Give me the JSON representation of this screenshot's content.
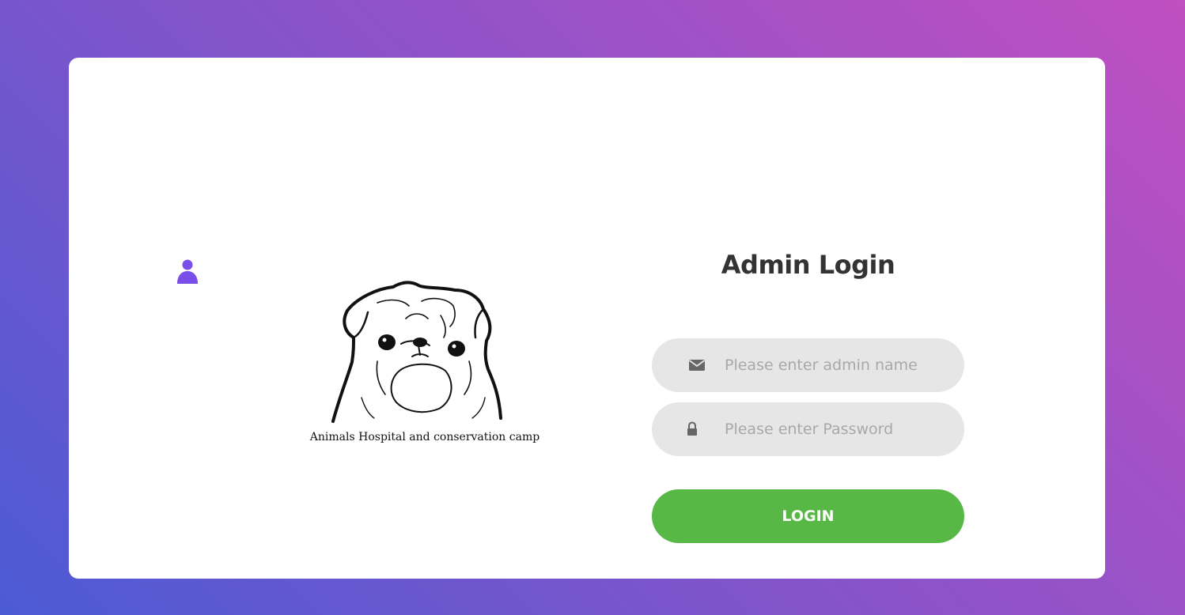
{
  "logo": {
    "caption": "Animals Hospital and conservation camp"
  },
  "form": {
    "title": "Admin Login",
    "email_placeholder": "Please enter admin name",
    "password_placeholder": "Please enter Password",
    "login_label": "LOGIN"
  },
  "colors": {
    "accent": "#57b846",
    "avatar": "#7a4ee8",
    "field_bg": "#e6e6e6"
  },
  "icons": {
    "avatar": "user-silhouette-icon",
    "email": "envelope-icon",
    "password": "lock-icon"
  }
}
